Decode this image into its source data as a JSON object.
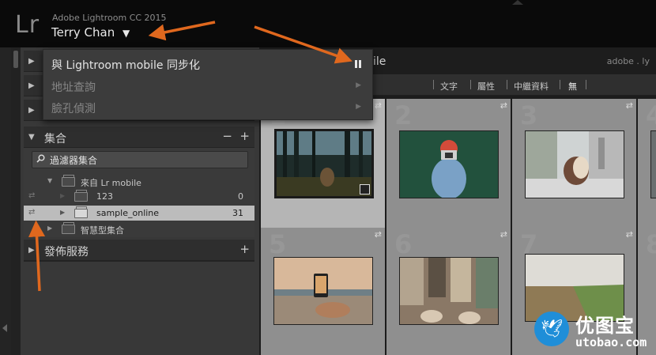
{
  "top": {
    "logo": "Lr",
    "app_name": "Adobe Lightroom CC 2015",
    "user_name": "Terry Chan",
    "user_caret": "▼"
  },
  "menu": {
    "items": [
      {
        "label": "與 Lightroom mobile 同步化",
        "active": true
      },
      {
        "label": "地址查詢",
        "active": false
      },
      {
        "label": "臉孔偵測",
        "active": false
      }
    ]
  },
  "panels": {
    "collections_title": "集合",
    "collections_minus": "−",
    "collections_plus": "+",
    "filter_placeholder": "過濾器集合",
    "tree": [
      {
        "label": "來自 Lr mobile",
        "count": ""
      },
      {
        "label": "123",
        "count": "0"
      },
      {
        "label": "sample_online",
        "count": "31"
      },
      {
        "label": "智慧型集合",
        "count": ""
      }
    ],
    "publish_title": "發佈服務",
    "publish_plus": "+"
  },
  "right_header": {
    "partial_title": "ile",
    "identity": "adobe . ly"
  },
  "filter_bar": {
    "items": [
      "文字",
      "屬性",
      "中繼資料",
      "無"
    ]
  },
  "grid": {
    "cells": [
      {
        "num": "1",
        "selected": true
      },
      {
        "num": "2",
        "selected": false
      },
      {
        "num": "3",
        "selected": false
      },
      {
        "num": "4",
        "selected": false
      },
      {
        "num": "5",
        "selected": false
      },
      {
        "num": "6",
        "selected": false
      },
      {
        "num": "7",
        "selected": false
      },
      {
        "num": "8",
        "selected": false
      }
    ],
    "sync_icon": "⇄"
  },
  "watermark": {
    "title": "优图宝",
    "sub": "utobao.com"
  },
  "colors": {
    "annotation_arrow": "#e0681e",
    "watermark_blue": "#1f8ed8"
  }
}
